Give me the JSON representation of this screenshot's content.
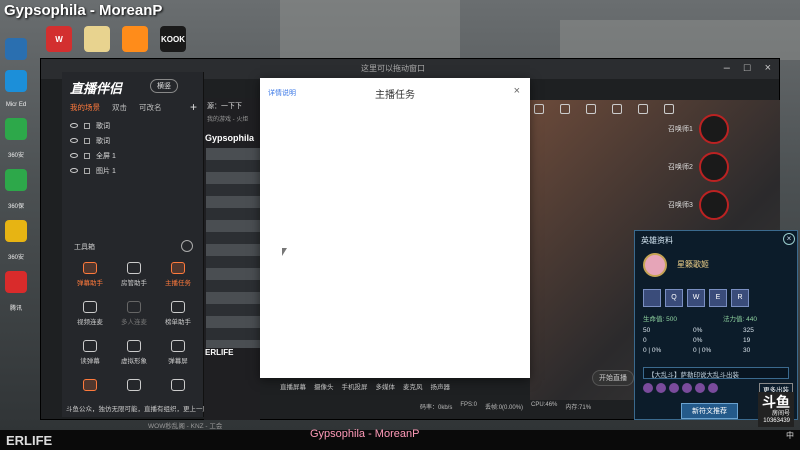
{
  "top_title": "Gypsophila - MoreanP",
  "desktop_icons": [
    {
      "name": "wps-icon",
      "label": "W",
      "color": "#d32f2f"
    },
    {
      "name": "files-icon",
      "label": "",
      "color": "#e8d38f"
    },
    {
      "name": "app-orange-icon",
      "label": "",
      "color": "#ff8c1a"
    },
    {
      "name": "kook-icon",
      "label": "KOOK",
      "color": "#1a1a1a"
    }
  ],
  "left_dock": [
    "",
    "Micr Ed",
    "360安",
    "360保",
    "360安",
    "腾讯"
  ],
  "drag_hint": "这里可以拖动窗口",
  "assistant": {
    "logo": "直播伴侣",
    "mode": "横竖",
    "tabs": [
      "我的场景",
      "双击",
      "可改名"
    ],
    "sources": [
      {
        "label": "歌词"
      },
      {
        "label": "歌词"
      },
      {
        "label": "全屏 1"
      },
      {
        "label": "图片 1"
      }
    ],
    "tools_title": "工具箱",
    "tools": [
      {
        "label": "弹幕助手",
        "state": "hl"
      },
      {
        "label": "房管助手",
        "state": ""
      },
      {
        "label": "主播任务",
        "state": "hl"
      },
      {
        "label": "视频连麦",
        "state": ""
      },
      {
        "label": "多人连麦",
        "state": "dim"
      },
      {
        "label": "榜单助手",
        "state": ""
      },
      {
        "label": "读弹幕",
        "state": ""
      },
      {
        "label": "虚拟形象",
        "state": ""
      },
      {
        "label": "弹幕屏",
        "state": ""
      },
      {
        "label": "",
        "state": "hl"
      },
      {
        "label": "",
        "state": ""
      },
      {
        "label": "",
        "state": ""
      }
    ],
    "footer": "斗鱼公众，独仿无限可能，直播有组织，更上一层楼"
  },
  "scene_col": {
    "head": "源：一下下",
    "sub": "我的游戏 - 火炬"
  },
  "gyps_small": "Gypsophila",
  "erlife_small": "ERLIFE",
  "modal": {
    "link": "详情说明",
    "title": "主播任务",
    "close": "×"
  },
  "bottom_tabs": [
    "直播屏幕",
    "摄像头",
    "手机投屏",
    "多媒体",
    "麦克风",
    "扬声器"
  ],
  "status_items": [
    "码率：0kb/s",
    "FPS:0",
    "丢帧:0(0.00%)",
    "CPU:46%",
    "内存:71%"
  ],
  "live_btn": "开始直播",
  "slots": [
    "召唤师1",
    "召唤师2",
    "召唤师3"
  ],
  "hero_panel": {
    "head": "英雄资料",
    "name": "星籁歌姬",
    "skills": [
      "",
      "Q",
      "W",
      "E",
      "R"
    ],
    "hp": "生命值: 500",
    "mp": "法力值: 440",
    "stats": [
      "50",
      "0%",
      "325",
      "0",
      "0%",
      "19",
      "0 | 0%",
      "0 | 0%",
      "30"
    ],
    "selector": "【大乱斗】萨勒印说大乱斗出装",
    "more": "更多出装",
    "recommend": "新符文推荐"
  },
  "watermark": {
    "brand": "斗鱼",
    "sub": "房间号",
    "room": "10363439"
  },
  "taskbar": {
    "erlife": "ERLIFE",
    "url": "WOW秒乱阁 - KNZ - 工会",
    "title": "Gypsophila - MoreanP",
    "clock": "中"
  }
}
